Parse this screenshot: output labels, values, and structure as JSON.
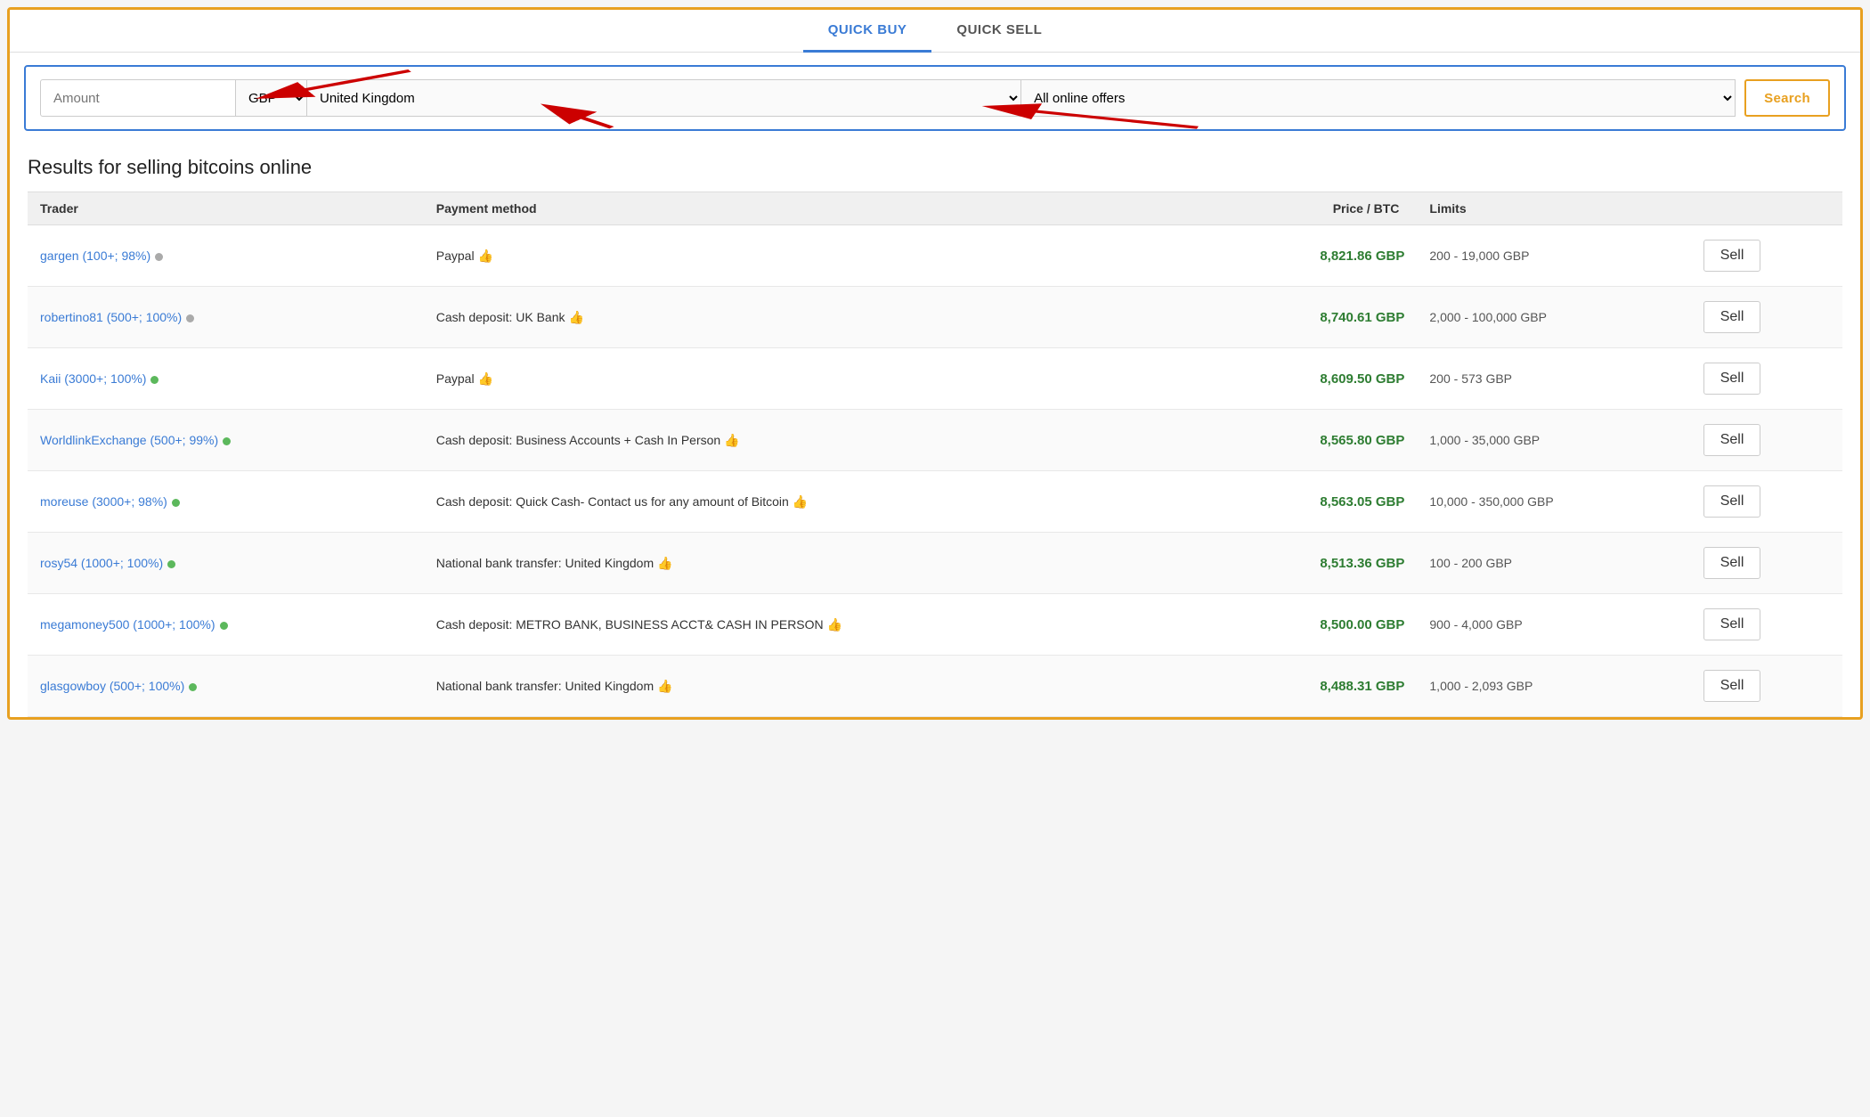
{
  "tabs": {
    "quick_buy": "QUICK BUY",
    "quick_sell": "QUICK SELL",
    "active": "quick_buy"
  },
  "search": {
    "amount_placeholder": "Amount",
    "currency": "GBP",
    "country": "United Kingdom",
    "offers": "All online offers",
    "search_btn": "Search"
  },
  "results": {
    "title": "Results for selling bitcoins online",
    "columns": {
      "trader": "Trader",
      "payment": "Payment method",
      "price": "Price / BTC",
      "limits": "Limits"
    },
    "rows": [
      {
        "trader": "gargen (100+; 98%)",
        "dot": "gray",
        "payment": "Paypal",
        "thumb": true,
        "price": "8,821.86 GBP",
        "limits": "200 - 19,000 GBP",
        "sell": "Sell"
      },
      {
        "trader": "robertino81 (500+; 100%)",
        "dot": "gray",
        "payment": "Cash deposit: UK Bank",
        "thumb": true,
        "price": "8,740.61 GBP",
        "limits": "2,000 - 100,000 GBP",
        "sell": "Sell"
      },
      {
        "trader": "Kaii (3000+; 100%)",
        "dot": "green",
        "payment": "Paypal",
        "thumb": true,
        "price": "8,609.50 GBP",
        "limits": "200 - 573 GBP",
        "sell": "Sell"
      },
      {
        "trader": "WorldlinkExchange (500+; 99%)",
        "dot": "green",
        "payment": "Cash deposit: Business Accounts + Cash In Person",
        "thumb": true,
        "price": "8,565.80 GBP",
        "limits": "1,000 - 35,000 GBP",
        "sell": "Sell"
      },
      {
        "trader": "moreuse (3000+; 98%)",
        "dot": "green",
        "payment": "Cash deposit: Quick Cash- Contact us for any amount of Bitcoin",
        "thumb": true,
        "price": "8,563.05 GBP",
        "limits": "10,000 - 350,000 GBP",
        "sell": "Sell"
      },
      {
        "trader": "rosy54 (1000+; 100%)",
        "dot": "green",
        "payment": "National bank transfer: United Kingdom",
        "thumb": true,
        "price": "8,513.36 GBP",
        "limits": "100 - 200 GBP",
        "sell": "Sell"
      },
      {
        "trader": "megamoney500 (1000+; 100%)",
        "dot": "green",
        "payment": "Cash deposit: METRO BANK, BUSINESS ACCT& CASH IN PERSON",
        "thumb": true,
        "price": "8,500.00 GBP",
        "limits": "900 - 4,000 GBP",
        "sell": "Sell"
      },
      {
        "trader": "glasgowboy (500+; 100%)",
        "dot": "green",
        "payment": "National bank transfer: United Kingdom",
        "thumb": true,
        "price": "8,488.31 GBP",
        "limits": "1,000 - 2,093 GBP",
        "sell": "Sell"
      }
    ]
  }
}
